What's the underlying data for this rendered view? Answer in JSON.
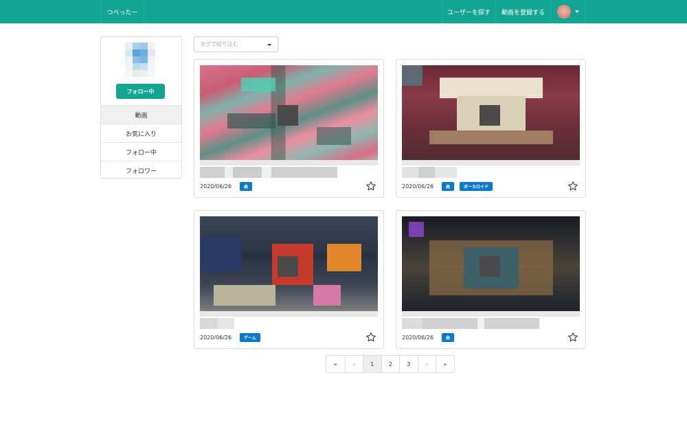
{
  "navbar": {
    "brand": "つべったー",
    "find_users": "ユーザーを探す",
    "register_video": "動画を登録する"
  },
  "profile": {
    "follow_button": "フォロー中",
    "menu": [
      "動画",
      "お気に入り",
      "フォロー中",
      "フォロワー"
    ]
  },
  "filter": {
    "tag_placeholder": "タグで絞り込む"
  },
  "videos": [
    {
      "date": "2020/06/26",
      "tags": [
        "曲"
      ]
    },
    {
      "date": "2020/06/26",
      "tags": [
        "曲",
        "ボーカロイド"
      ]
    },
    {
      "date": "2020/06/26",
      "tags": [
        "ゲーム"
      ]
    },
    {
      "date": "2020/06/26",
      "tags": [
        "曲"
      ]
    }
  ],
  "pagination": {
    "first": "«",
    "prev": "‹",
    "pages": [
      "1",
      "2",
      "3"
    ],
    "next": "›",
    "last": "»",
    "current_page": 1
  },
  "colors": {
    "primary": "#13a594",
    "tag": "#0c78c9"
  },
  "icons": {
    "favorite": "star-outline-icon",
    "dropdown": "caret-down-icon"
  }
}
